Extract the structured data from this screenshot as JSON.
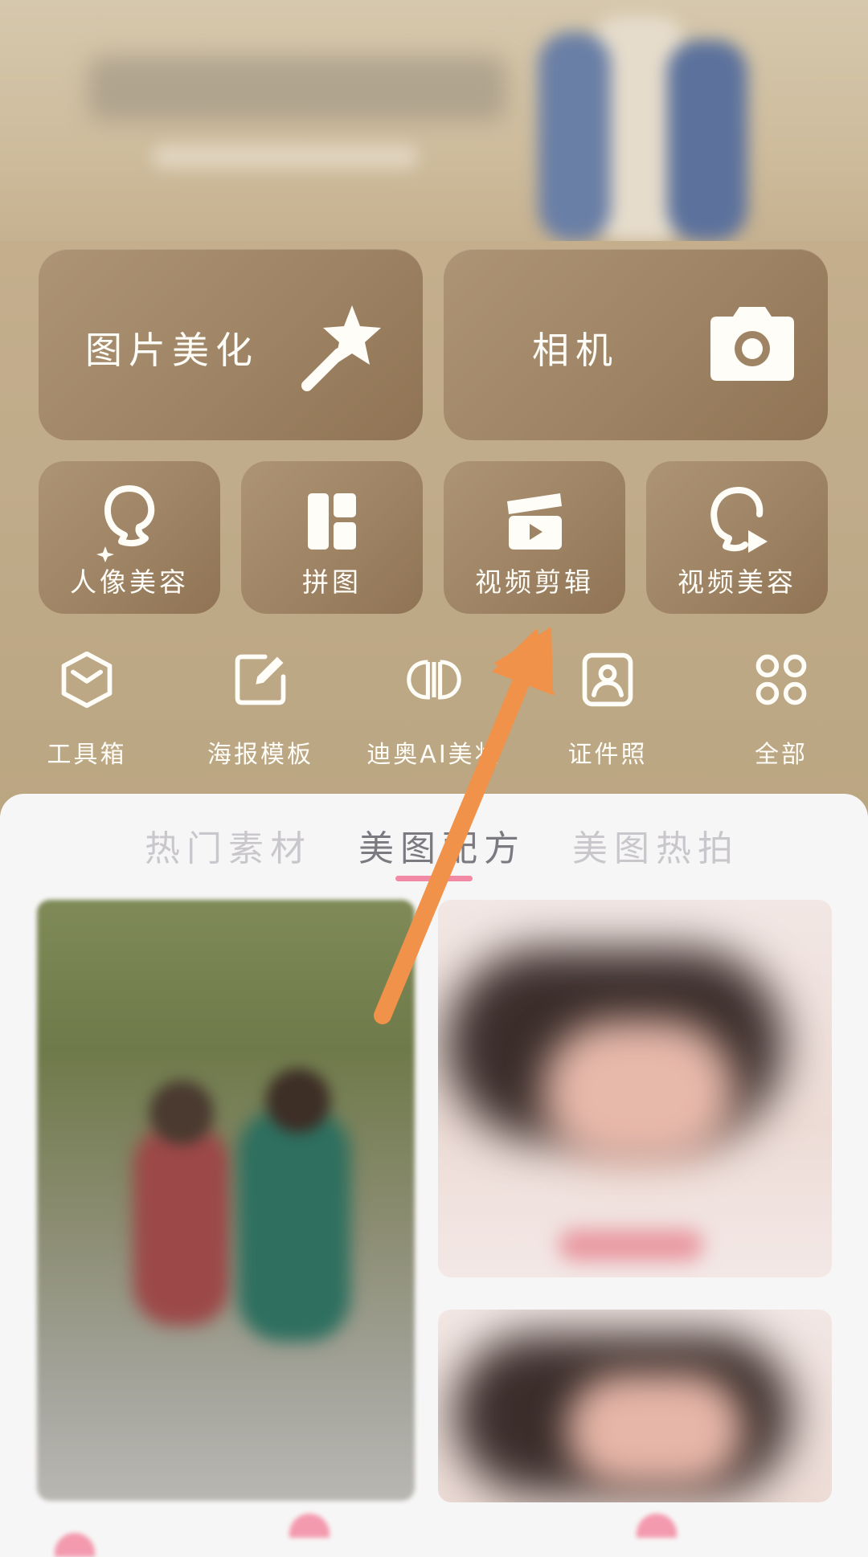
{
  "main_cards": {
    "beautify": "图片美化",
    "camera": "相机"
  },
  "feature_cards": [
    {
      "label": "人像美容",
      "icon": "portrait-icon"
    },
    {
      "label": "拼图",
      "icon": "collage-icon"
    },
    {
      "label": "视频剪辑",
      "icon": "clapperboard-icon"
    },
    {
      "label": "视频美容",
      "icon": "video-beauty-icon"
    }
  ],
  "tools": [
    {
      "label": "工具箱",
      "icon": "toolbox-icon"
    },
    {
      "label": "海报模板",
      "icon": "edit-square-icon"
    },
    {
      "label": "迪奥AI美妆",
      "icon": "dior-logo-icon"
    },
    {
      "label": "证件照",
      "icon": "id-photo-icon"
    },
    {
      "label": "全部",
      "icon": "grid-all-icon"
    }
  ],
  "tabs": [
    {
      "label": "热门素材",
      "active": false
    },
    {
      "label": "美图配方",
      "active": true
    },
    {
      "label": "美图热拍",
      "active": false
    }
  ],
  "colors": {
    "card": "#9e8464",
    "tab_active_underline": "#f28aa5",
    "annotation_arrow": "#f0924a"
  }
}
